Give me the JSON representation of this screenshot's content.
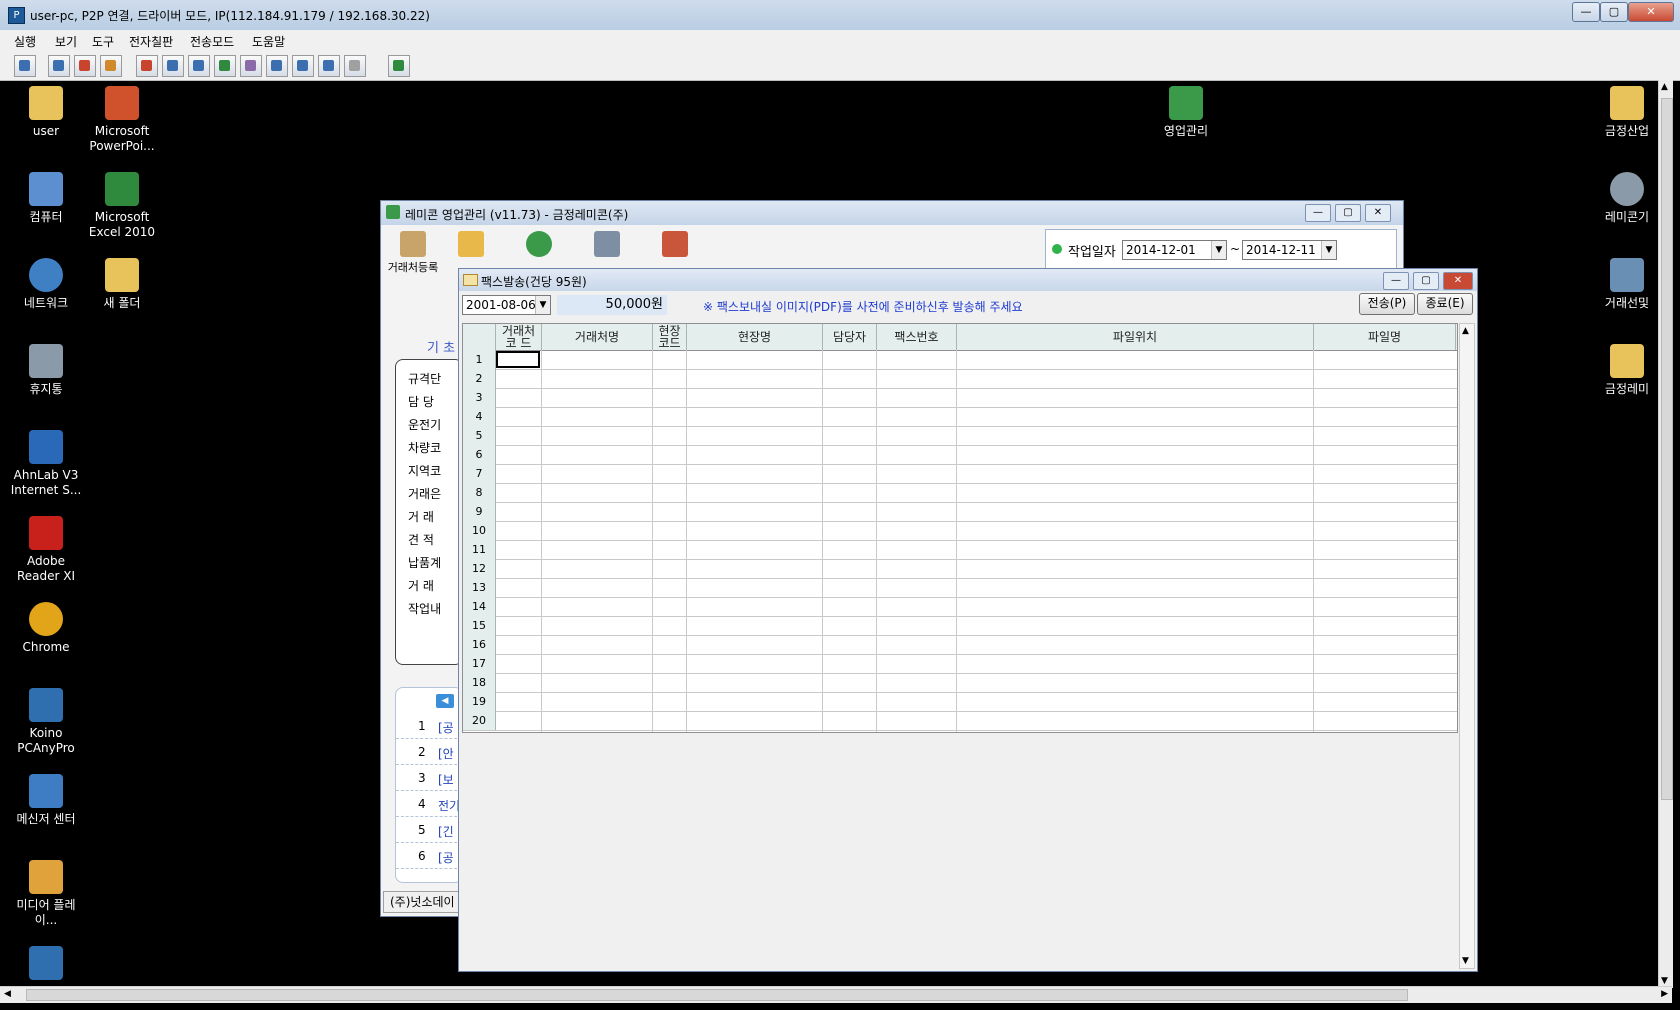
{
  "remote": {
    "title": "user-pc, P2P 연결, 드라이버 모드, IP(112.184.91.179 / 192.168.30.22)",
    "menu": [
      "실행",
      "보기",
      "도구",
      "전자칠판",
      "전송모드",
      "도움말"
    ]
  },
  "desktop_left": [
    {
      "label": "user",
      "icon": "folder-icon",
      "color": "#e8c35c"
    },
    {
      "label": "Microsoft PowerPoi...",
      "icon": "powerpoint-icon",
      "color": "#d0522c"
    },
    {
      "label": "컴퓨터",
      "icon": "computer-icon",
      "color": "#5b8fd0"
    },
    {
      "label": "Microsoft Excel 2010",
      "icon": "excel-icon",
      "color": "#2f8a3e"
    },
    {
      "label": "네트워크",
      "icon": "network-icon",
      "color": "#3f7fc4"
    },
    {
      "label": "새 폴더",
      "icon": "folder-icon",
      "color": "#e8c35c"
    },
    {
      "label": "휴지통",
      "icon": "recycle-bin-icon",
      "color": "#8a9aa8"
    },
    {
      "label": "AhnLab V3 Internet S...",
      "icon": "ahnlab-icon",
      "color": "#2a69b8"
    },
    {
      "label": "Adobe Reader XI",
      "icon": "adobe-reader-icon",
      "color": "#c8201b"
    },
    {
      "label": "Chrome",
      "icon": "chrome-icon",
      "color": "#e2a418"
    },
    {
      "label": "Koino PCAnyPro",
      "icon": "pcanypro-icon",
      "color": "#2f6fb0"
    },
    {
      "label": "메신저 센터",
      "icon": "messenger-icon",
      "color": "#3e7cc4"
    },
    {
      "label": "미디어 플레이...",
      "icon": "media-player-icon",
      "color": "#e0a23a"
    },
    {
      "label": "",
      "icon": "app-icon",
      "color": "#2f6fb0"
    }
  ],
  "desktop_right": [
    {
      "label": "영업관리",
      "icon": "sales-app-icon",
      "color": "#3b9a4a"
    },
    {
      "label": "금정산업",
      "icon": "folder-icon",
      "color": "#e8c35c"
    },
    {
      "label": "레미콘기",
      "icon": "search-icon",
      "color": "#8a9aa8"
    },
    {
      "label": "거래선및",
      "icon": "people-icon",
      "color": "#6a8fb5"
    },
    {
      "label": "금정레미",
      "icon": "folder-icon",
      "color": "#e8c35c"
    }
  ],
  "back_window": {
    "title": "레미콘 영업관리 (v11.73) - 금정레미콘(주)",
    "toolbar": [
      "거래처등록",
      "",
      "",
      "",
      ""
    ],
    "work_date_label": "작업일자",
    "date_from": "2014-12-01",
    "tilde": "~",
    "date_to": "2014-12-11",
    "section_title": "기 초",
    "left_labels": [
      "규격단",
      "담 당",
      "운전기",
      "차량코",
      "지역코",
      "거래은",
      "거 래",
      "견 적",
      "납품계",
      "거 래",
      "작업내"
    ],
    "notice_rows": [
      {
        "n": "1",
        "text": "[공"
      },
      {
        "n": "2",
        "text": "[안"
      },
      {
        "n": "3",
        "text": "[보"
      },
      {
        "n": "4",
        "text": "전기"
      },
      {
        "n": "5",
        "text": "[긴"
      },
      {
        "n": "6",
        "text": "[공"
      }
    ],
    "status": "(주)넛소데이"
  },
  "fax_window": {
    "title": "팩스발송(건당 95원)",
    "date": "2001-08-06",
    "amount": "50,000원",
    "notice": "※ 팩스보내실 이미지(PDF)를 사전에 준비하신후 발송해 주세요",
    "send_button": "전송(P)",
    "close_button": "종료(E)",
    "columns": [
      "거래처 코 드",
      "거래처명",
      "현장 코드",
      "현장명",
      "담당자",
      "팩스번호",
      "파일위치",
      "파일명"
    ],
    "rows": [
      "1",
      "2",
      "3",
      "4",
      "5",
      "6",
      "7",
      "8",
      "9",
      "10",
      "11",
      "12",
      "13",
      "14",
      "15",
      "16",
      "17",
      "18",
      "19",
      "20"
    ]
  }
}
